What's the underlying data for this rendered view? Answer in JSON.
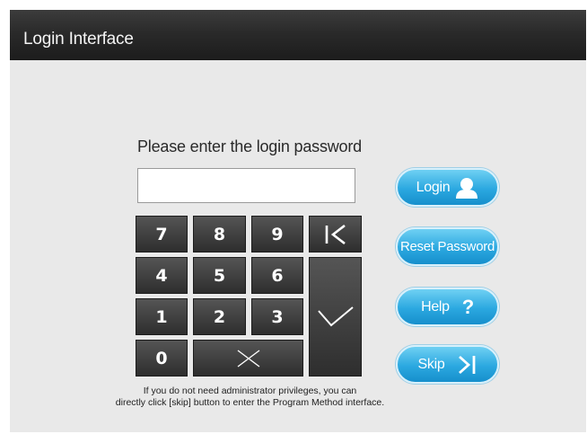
{
  "window": {
    "title": "Login Interface"
  },
  "login": {
    "prompt": "Please enter the login password",
    "password_value": "",
    "password_placeholder": ""
  },
  "keypad": {
    "digits": [
      "7",
      "8",
      "9",
      "4",
      "5",
      "6",
      "1",
      "2",
      "3",
      "0"
    ]
  },
  "buttons": {
    "login_label": "Login",
    "reset_label": "Reset Password",
    "help_label": "Help",
    "skip_label": "Skip"
  },
  "icons": {
    "backspace": "backspace-icon",
    "confirm": "checkmark-icon",
    "clear": "clear-x-icon",
    "user": "user-icon",
    "help": "question-mark-icon",
    "skip": "skip-forward-icon"
  },
  "footer": {
    "note_line1": "If you do not need administrator privileges, you can",
    "note_line2": "directly click [skip] button to enter the Program Method interface."
  },
  "colors": {
    "title_bar": "#2a2a2a",
    "background": "#e9e9e9",
    "key": "#3a3a3a",
    "accent_button": "#2ba8e0"
  }
}
